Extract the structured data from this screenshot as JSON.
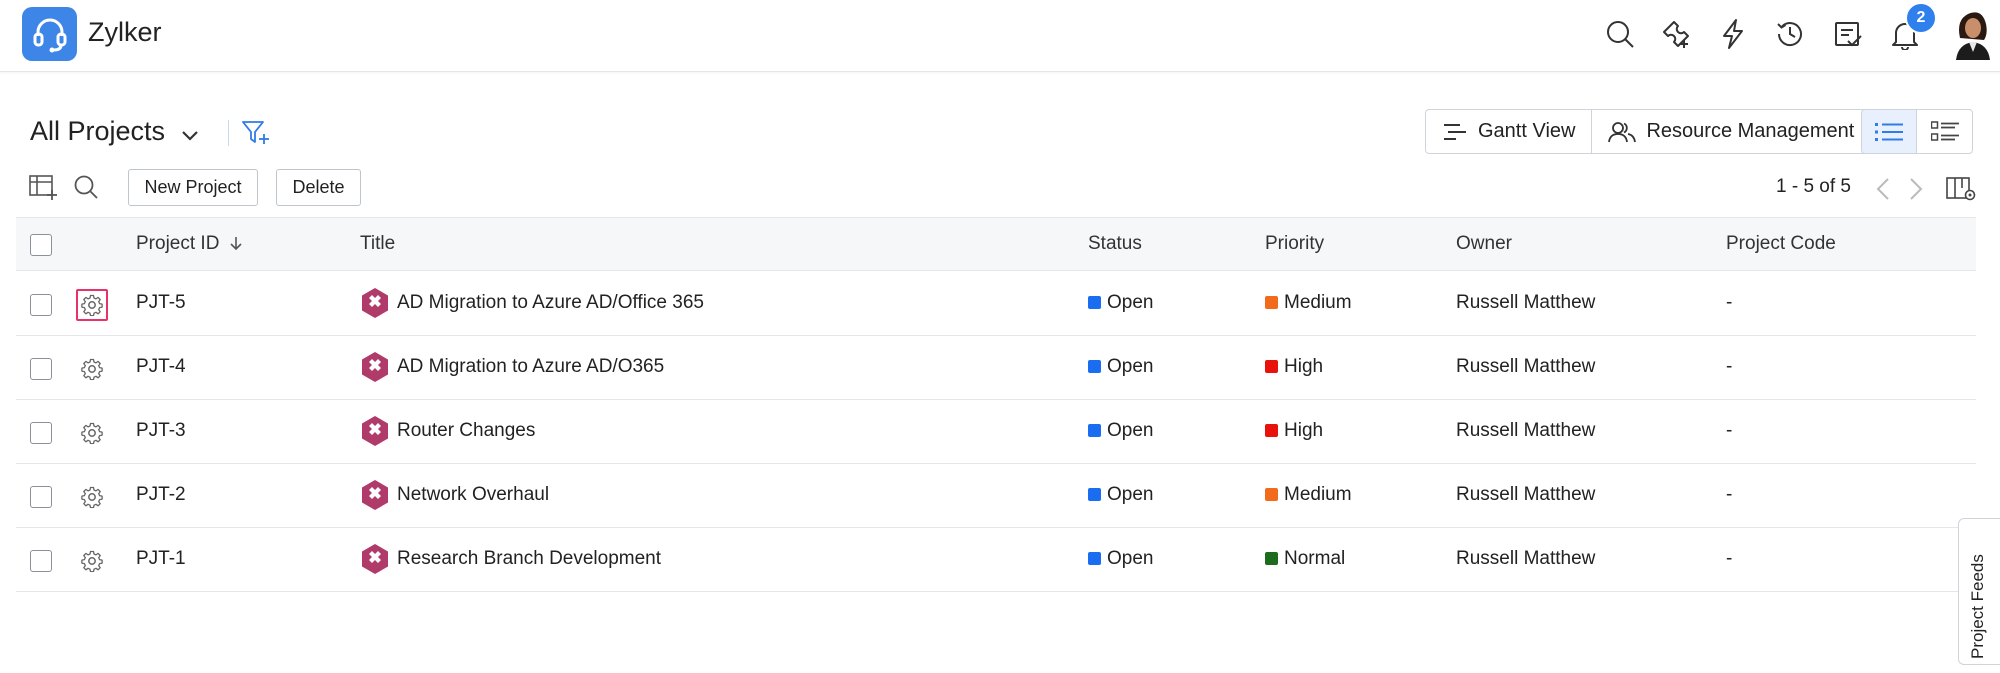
{
  "app": {
    "name": "Zylker"
  },
  "header": {
    "notifications_count": "2",
    "icons": [
      "search-icon",
      "add-ticket-icon",
      "lightning-icon",
      "history-icon",
      "tasks-icon",
      "bell-icon"
    ]
  },
  "view": {
    "title": "All Projects",
    "gantt_label": "Gantt View",
    "resource_label": "Resource Management"
  },
  "toolbar": {
    "new_project": "New Project",
    "delete": "Delete",
    "pager": "1 - 5 of 5"
  },
  "table": {
    "columns": {
      "project_id": "Project ID",
      "title": "Title",
      "status": "Status",
      "priority": "Priority",
      "owner": "Owner",
      "project_code": "Project Code"
    },
    "rows": [
      {
        "id": "PJT-5",
        "title": "AD Migration to Azure AD/Office 365",
        "status": "Open",
        "priority": "Medium",
        "owner": "Russell Matthew",
        "code": "-"
      },
      {
        "id": "PJT-4",
        "title": "AD Migration to Azure AD/O365",
        "status": "Open",
        "priority": "High",
        "owner": "Russell Matthew",
        "code": "-"
      },
      {
        "id": "PJT-3",
        "title": "Router Changes",
        "status": "Open",
        "priority": "High",
        "owner": "Russell Matthew",
        "code": "-"
      },
      {
        "id": "PJT-2",
        "title": "Network Overhaul",
        "status": "Open",
        "priority": "Medium",
        "owner": "Russell Matthew",
        "code": "-"
      },
      {
        "id": "PJT-1",
        "title": "Research Branch Development",
        "status": "Open",
        "priority": "Normal",
        "owner": "Russell Matthew",
        "code": "-"
      }
    ]
  },
  "colors": {
    "accent": "#3d86e8",
    "status_open": "#1a6cf0",
    "priority_medium": "#f26b1d",
    "priority_high": "#e8120c",
    "priority_normal": "#1e6b1e",
    "project_icon": "#b03a6a",
    "highlight": "#e8326a"
  },
  "side_tab": {
    "label": "Project Feeds"
  }
}
